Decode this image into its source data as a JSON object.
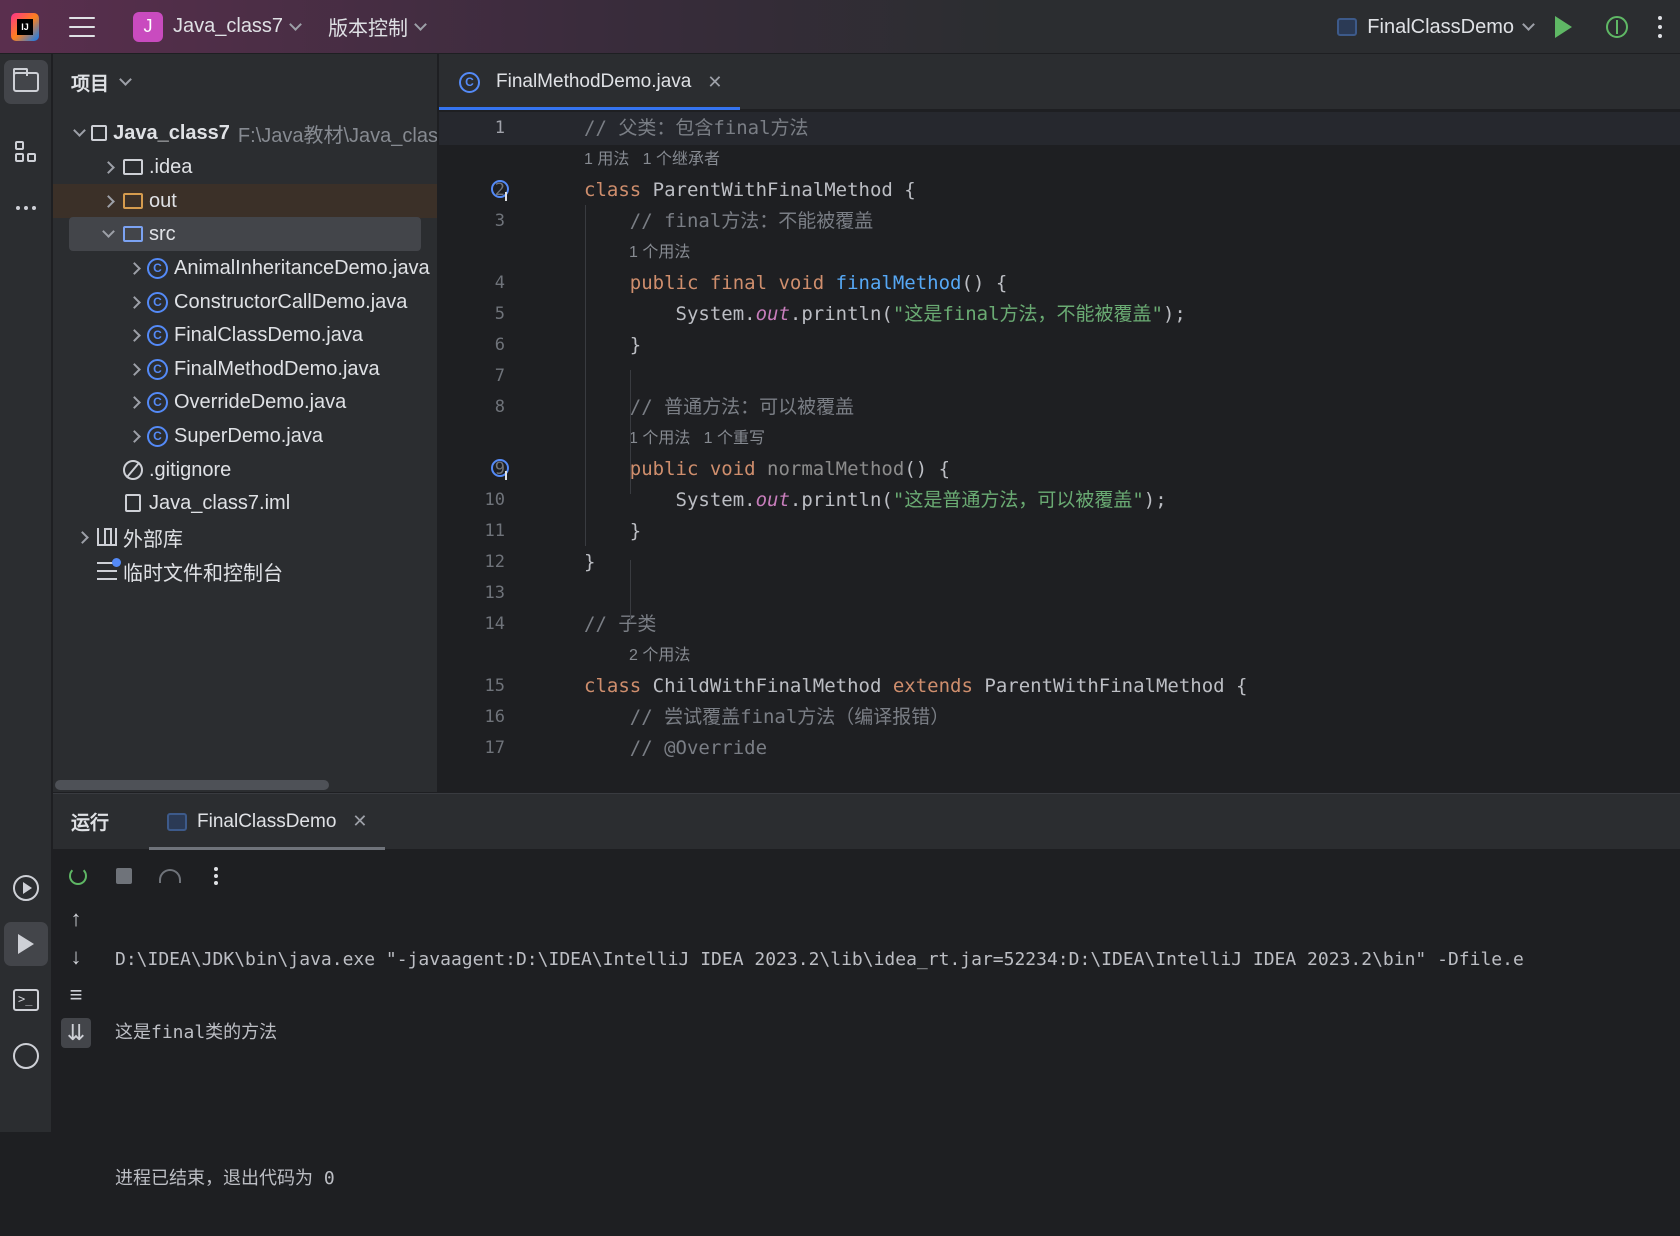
{
  "titlebar": {
    "project_initial": "J",
    "project_name": "Java_class7",
    "vcs_label": "版本控制",
    "run_config": "FinalClassDemo"
  },
  "project_panel": {
    "title": "项目",
    "tree": [
      {
        "label": "Java_class7",
        "sub": "F:\\Java教材\\Java_clas",
        "type": "module"
      },
      {
        "label": ".idea",
        "type": "folder"
      },
      {
        "label": "out",
        "type": "folder-excluded"
      },
      {
        "label": "src",
        "type": "folder-source"
      },
      {
        "label": "AnimalInheritanceDemo.java",
        "type": "class"
      },
      {
        "label": "ConstructorCallDemo.java",
        "type": "class"
      },
      {
        "label": "FinalClassDemo.java",
        "type": "class"
      },
      {
        "label": "FinalMethodDemo.java",
        "type": "class"
      },
      {
        "label": "OverrideDemo.java",
        "type": "class"
      },
      {
        "label": "SuperDemo.java",
        "type": "class"
      },
      {
        "label": ".gitignore",
        "type": "ignore"
      },
      {
        "label": "Java_class7.iml",
        "type": "iml"
      },
      {
        "label": "外部库",
        "type": "library"
      },
      {
        "label": "临时文件和控制台",
        "type": "scratch"
      }
    ]
  },
  "editor": {
    "tab_label": "FinalMethodDemo.java",
    "class_icon_letter": "C",
    "lines": [
      {
        "n": "1",
        "parts": [
          [
            "cm",
            "// 父类：包含final方法"
          ]
        ]
      },
      {
        "hint": "1 用法   1 个继承者"
      },
      {
        "n": "2",
        "parts": [
          [
            "kw",
            "class "
          ],
          [
            "",
            "ParentWithFinalMethod {"
          ]
        ]
      },
      {
        "n": "3",
        "parts": [
          [
            "",
            "    "
          ],
          [
            "cm",
            "// final方法：不能被覆盖"
          ]
        ]
      },
      {
        "hint": "1 个用法"
      },
      {
        "n": "4",
        "parts": [
          [
            "",
            "    "
          ],
          [
            "kw",
            "public final void "
          ],
          [
            "fn",
            "finalMethod"
          ],
          [
            "",
            "() {"
          ]
        ]
      },
      {
        "n": "5",
        "parts": [
          [
            "",
            "        System."
          ],
          [
            "fld-it",
            "out"
          ],
          [
            "",
            ".println("
          ],
          [
            "str",
            "\"这是final方法，不能被覆盖\""
          ],
          [
            "",
            ");"
          ]
        ]
      },
      {
        "n": "6",
        "parts": [
          [
            "",
            "    }"
          ]
        ]
      },
      {
        "n": "7",
        "parts": []
      },
      {
        "n": "8",
        "parts": [
          [
            "",
            "    "
          ],
          [
            "cm",
            "// 普通方法：可以被覆盖"
          ]
        ]
      },
      {
        "hint": "1 个用法   1 个重写"
      },
      {
        "n": "9",
        "parts": [
          [
            "",
            "    "
          ],
          [
            "kw",
            "public void "
          ],
          [
            "gray-fn",
            "normalMethod"
          ],
          [
            "",
            "() {"
          ]
        ]
      },
      {
        "n": "10",
        "parts": [
          [
            "",
            "        System."
          ],
          [
            "fld-it",
            "out"
          ],
          [
            "",
            ".println("
          ],
          [
            "str",
            "\"这是普通方法，可以被覆盖\""
          ],
          [
            "",
            ");"
          ]
        ]
      },
      {
        "n": "11",
        "parts": [
          [
            "",
            "    }"
          ]
        ]
      },
      {
        "n": "12",
        "parts": [
          [
            "",
            "}"
          ]
        ]
      },
      {
        "n": "13",
        "parts": []
      },
      {
        "n": "14",
        "parts": [
          [
            "cm",
            "// 子类"
          ]
        ]
      },
      {
        "hint": "2 个用法"
      },
      {
        "n": "15",
        "parts": [
          [
            "kw",
            "class "
          ],
          [
            "",
            "ChildWithFinalMethod "
          ],
          [
            "kw",
            "extends "
          ],
          [
            "",
            "ParentWithFinalMethod {"
          ]
        ]
      },
      {
        "n": "16",
        "parts": [
          [
            "",
            "    "
          ],
          [
            "cm",
            "// 尝试覆盖final方法（编译报错）"
          ]
        ]
      },
      {
        "n": "17",
        "parts": [
          [
            "",
            "    "
          ],
          [
            "cm",
            "// @Override"
          ]
        ]
      }
    ]
  },
  "run_panel": {
    "title": "运行",
    "tab_label": "FinalClassDemo",
    "console": [
      "D:\\IDEA\\JDK\\bin\\java.exe \"-javaagent:D:\\IDEA\\IntelliJ IDEA 2023.2\\lib\\idea_rt.jar=52234:D:\\IDEA\\IntelliJ IDEA 2023.2\\bin\" -Dfile.e",
      "这是final类的方法",
      "",
      "进程已结束，退出代码为 0"
    ]
  },
  "colors": {
    "accent": "#3574f0",
    "keyword": "#cf8e6d",
    "string": "#6aab73",
    "comment": "#7a7e85",
    "method": "#56a8f5"
  }
}
